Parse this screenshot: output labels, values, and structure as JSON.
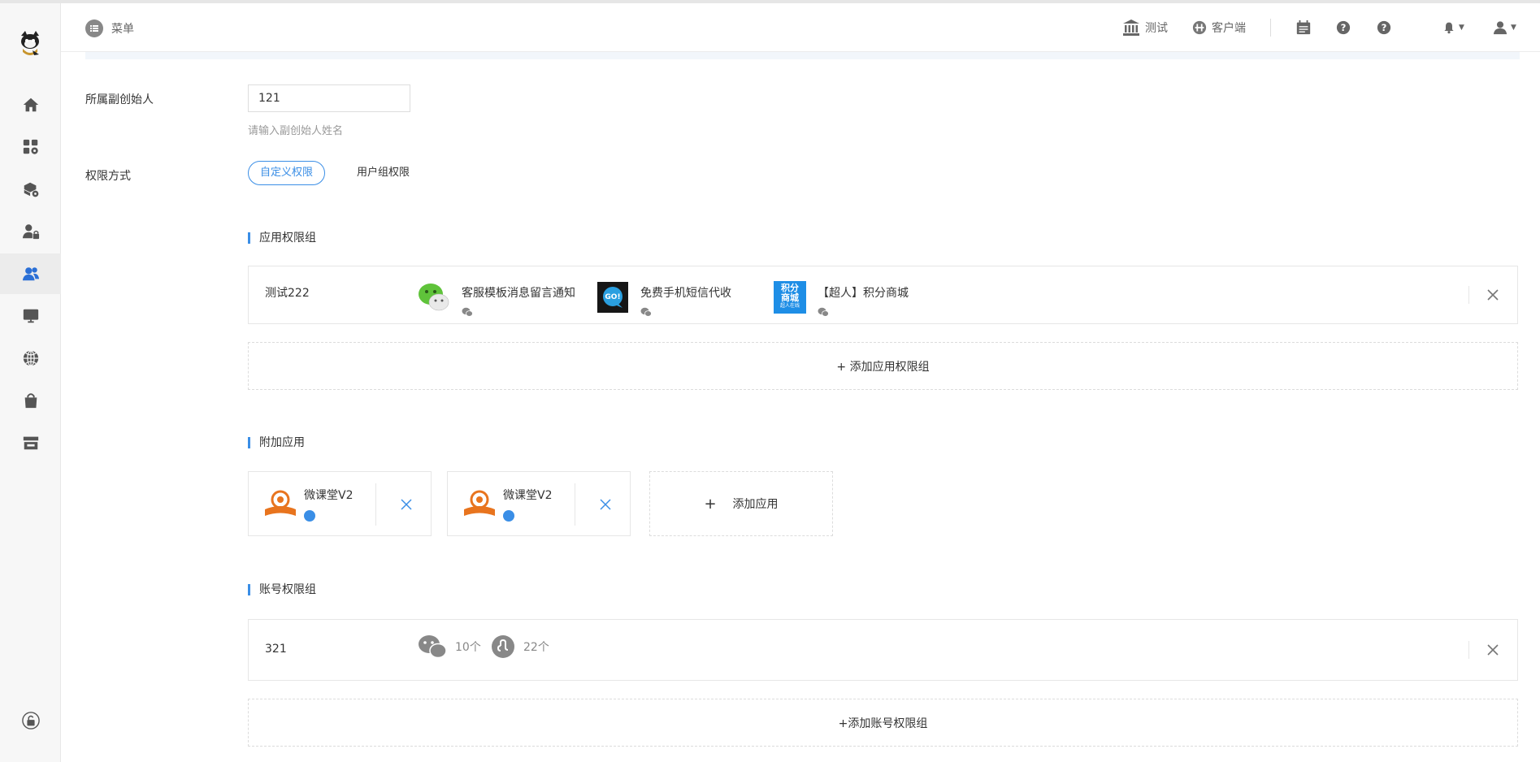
{
  "header": {
    "menu_label": "菜单",
    "links": [
      {
        "icon": "bank-icon",
        "label": "测试"
      },
      {
        "icon": "client-icon",
        "label": "客户端"
      }
    ]
  },
  "sidebar": {
    "items": [
      {
        "icon": "home-icon"
      },
      {
        "icon": "apps-settings-icon"
      },
      {
        "icon": "package-settings-icon"
      },
      {
        "icon": "user-lock-icon"
      },
      {
        "icon": "users-icon",
        "active": true
      },
      {
        "icon": "monitor-icon"
      },
      {
        "icon": "globe-icon"
      },
      {
        "icon": "bag-icon"
      },
      {
        "icon": "store-icon"
      }
    ],
    "bottom_icon": "unlock-icon"
  },
  "form": {
    "founder_label": "所属副创始人",
    "founder_value": "121",
    "founder_hint": "请输入副创始人姓名",
    "perm_label": "权限方式",
    "perm_options": [
      "自定义权限",
      "用户组权限"
    ],
    "perm_selected": "自定义权限"
  },
  "app_group": {
    "title": "应用权限组",
    "card_name": "测试222",
    "apps": [
      {
        "name": "客服模板消息留言通知"
      },
      {
        "name": "免费手机短信代收"
      },
      {
        "name": "【超人】积分商城",
        "icon_text": "积分商城",
        "icon_subtext": "超人在线"
      }
    ],
    "add_label": "+ 添加应用权限组"
  },
  "addon": {
    "title": "附加应用",
    "items": [
      {
        "name": "微课堂V2"
      },
      {
        "name": "微课堂V2"
      }
    ],
    "add_plus": "+",
    "add_label": "添加应用"
  },
  "account_group": {
    "title": "账号权限组",
    "card_name": "321",
    "counts": [
      {
        "icon": "wechat-icon",
        "count": "10个"
      },
      {
        "icon": "miniprogram-icon",
        "count": "22个"
      }
    ],
    "add_label": "+添加账号权限组"
  },
  "colors": {
    "accent": "#3a8ee6",
    "sidebar_active": "#2a6fd6"
  }
}
